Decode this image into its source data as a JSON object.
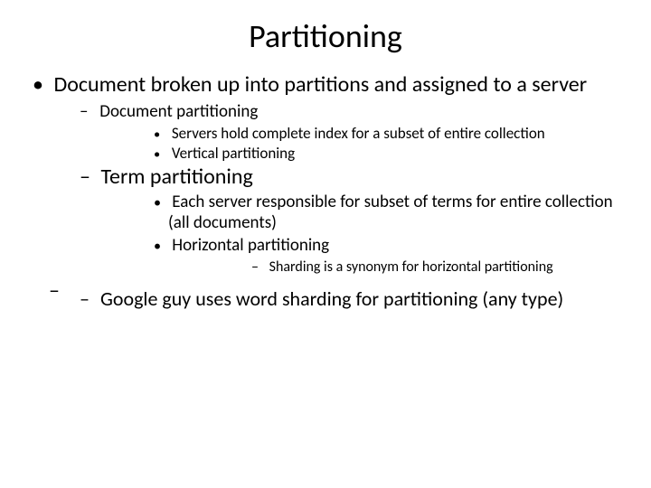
{
  "title": "Partitioning",
  "bullets": {
    "l1_0": "Document broken up into partitions and assigned to a server",
    "l2_0": "Document partitioning",
    "l3_0": "Servers hold complete index for a subset of entire collection",
    "l3_1": "Vertical partitioning",
    "l2_1": "Term partitioning",
    "l3_2": "Each server responsible for subset of terms for entire collection (all documents)",
    "l3_3": "Horizontal partitioning",
    "l4_0": "Sharding is a synonym for horizontal partitioning",
    "l2_2": "Google guy uses word sharding for partitioning (any type)"
  }
}
